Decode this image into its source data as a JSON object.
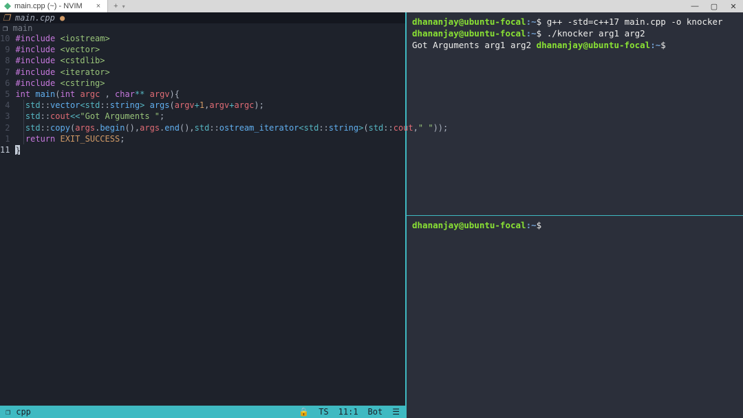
{
  "window": {
    "tab_title": "main.cpp (~) - NVIM",
    "btn_min": "—",
    "btn_max": "▢",
    "btn_close": "✕",
    "tab_close": "×",
    "newtab_plus": "+",
    "newtab_chevron": "▾"
  },
  "editor": {
    "buffer_badge": "❐",
    "buffer_name": "main.cpp",
    "modified_flag": "●",
    "func_badge": "❐",
    "func_label": "main",
    "gutter_lines": [
      "10",
      "9",
      "8",
      "7",
      "6",
      "5",
      "4",
      "3",
      "2",
      "1",
      "11"
    ],
    "gutter_current_index": 10,
    "code_rows": [
      {
        "type": "include",
        "text": "#include <iostream>"
      },
      {
        "type": "include",
        "text": "#include <vector>"
      },
      {
        "type": "include",
        "text": "#include <cstdlib>"
      },
      {
        "type": "include",
        "text": "#include <iterator>"
      },
      {
        "type": "include",
        "text": "#include <cstring>"
      },
      {
        "type": "main_sig"
      },
      {
        "type": "body1"
      },
      {
        "type": "body2"
      },
      {
        "type": "body3"
      },
      {
        "type": "body4"
      },
      {
        "type": "cursor",
        "char": "}"
      }
    ]
  },
  "status": {
    "badge": "❐",
    "filetype": "cpp",
    "lock": "🔒",
    "ts": "TS",
    "pos": "11:1",
    "scroll": "Bot",
    "menu": "☰"
  },
  "terminal_top": {
    "user": "dhananjay@ubuntu-focal",
    "path": "~",
    "cmd1": "g++ -std=c++17 main.cpp -o knocker",
    "cmd2": "./knocker arg1 arg2",
    "output": "Got Arguments arg1 arg2 "
  },
  "terminal_bottom": {
    "user": "dhananjay@ubuntu-focal",
    "path": "~"
  }
}
